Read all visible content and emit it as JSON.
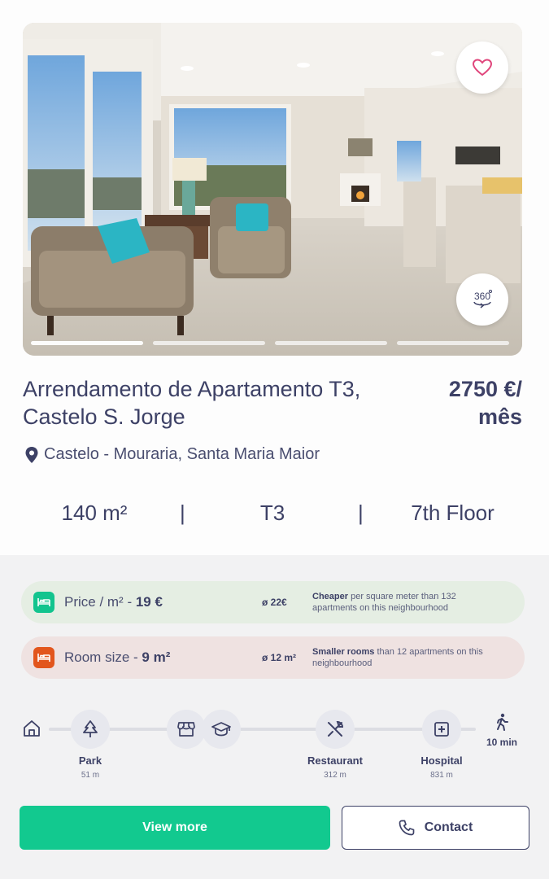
{
  "listing": {
    "title": "Arrendamento de Apartamento T3, Castelo S. Jorge",
    "price_line1": "2750 €/",
    "price_line2": "mês",
    "location": "Castelo - Mouraria, Santa Maria Maior",
    "favorite_icon": "heart-icon",
    "tour_label": "360",
    "gallery": {
      "slides": 4,
      "active_slide": 1
    }
  },
  "specs": {
    "area": "140 m²",
    "typology": "T3",
    "floor": "7th Floor",
    "separator": "|"
  },
  "insights": [
    {
      "icon": "bed-icon",
      "color": "#12c48e",
      "label": "Price / m² - ",
      "value": "19 €",
      "average": "ø 22€",
      "desc_bold": "Cheaper",
      "desc_rest": " per square meter than 132 apartments on this neighbourhood"
    },
    {
      "icon": "bed-icon",
      "color": "#e2561d",
      "label": "Room size - ",
      "value": "9 m²",
      "average": "ø 12 m²",
      "desc_bold": "Smaller rooms",
      "desc_rest": " than 12 apartments on this neighbourhood"
    }
  ],
  "proximity": {
    "origin_icon": "home-icon",
    "walk_time": "10 min",
    "pois": [
      {
        "icon": "tree-icon",
        "label": "Park",
        "distance": "51 m"
      },
      {
        "icon": "store-icon",
        "label": "",
        "distance": ""
      },
      {
        "icon": "graduation-cap-icon",
        "label": "",
        "distance": ""
      },
      {
        "icon": "restaurant-icon",
        "label": "Restaurant",
        "distance": "312 m"
      },
      {
        "icon": "hospital-icon",
        "label": "Hospital",
        "distance": "831 m"
      }
    ]
  },
  "actions": {
    "view_more": "View more",
    "contact": "Contact"
  }
}
